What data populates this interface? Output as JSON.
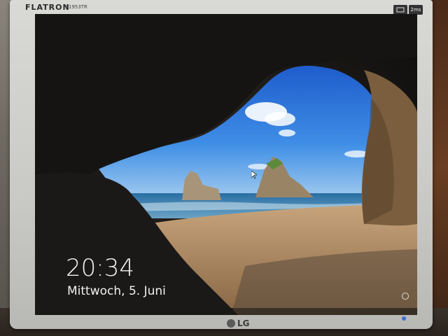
{
  "monitor": {
    "brand": "FLATRON",
    "model": "L1953TR",
    "bottom_logo": "LG",
    "badge_text": "2ms"
  },
  "lockscreen": {
    "time": "20:34",
    "date": "Mittwoch, 5. Juni"
  },
  "icons": {
    "accessibility": "ease-of-access-icon",
    "cursor": "mouse-pointer-icon",
    "power": "power-led-icon"
  },
  "colors": {
    "sky": "#2f7be0",
    "sea": "#3a7fae",
    "sand": "#b28d63",
    "cave": "#1a1816"
  }
}
